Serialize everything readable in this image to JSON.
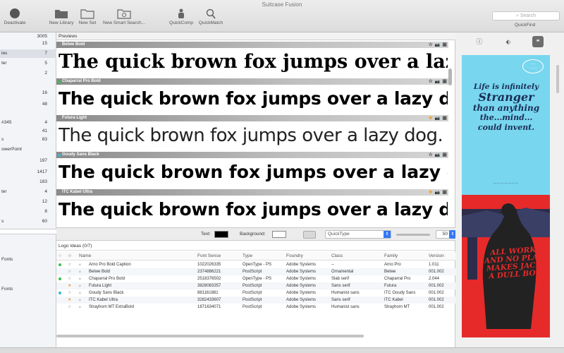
{
  "window": {
    "title": "Suitcase Fusion"
  },
  "toolbar": {
    "deactivate_label": "Deactivate",
    "new_library_label": "New Library",
    "new_set_label": "New Set",
    "new_smart_search_label": "New Smart Search...",
    "quickcomp_label": "QuickComp",
    "quickmatch_label": "QuickMatch",
    "search_placeholder": "Search",
    "quickfind_label": "QuickFind"
  },
  "sidebar": {
    "rows": [
      {
        "label": "",
        "count": "3005"
      },
      {
        "label": "",
        "count": "15"
      },
      {
        "label": "ies",
        "count": "7"
      },
      {
        "label": "ter",
        "count": "5"
      },
      {
        "label": "",
        "count": "2"
      },
      {
        "label": "",
        "count": "16"
      },
      {
        "label": "",
        "count": "48"
      },
      {
        "label": "#345",
        "count": "4"
      },
      {
        "label": "",
        "count": "41"
      },
      {
        "label": "s",
        "count": "83"
      },
      {
        "label": "owerPoint",
        "count": ""
      },
      {
        "label": "",
        "count": "197"
      },
      {
        "label": "",
        "count": "1417"
      },
      {
        "label": "",
        "count": "183"
      },
      {
        "label": "ter",
        "count": "4"
      },
      {
        "label": "",
        "count": "12"
      },
      {
        "label": "",
        "count": "8"
      },
      {
        "label": "s",
        "count": "60"
      },
      {
        "label": "Fonts",
        "count": ""
      },
      {
        "label": "Fonts",
        "count": ""
      }
    ]
  },
  "previews": {
    "header": "Previews",
    "sample_text": "The quick brown fox jumps over a lazy dog.",
    "fonts": [
      {
        "name": "Belwe Bold",
        "dot_color": "",
        "starred": false
      },
      {
        "name": "Chaparral Pro Bold",
        "dot_color": "#3dbd4a",
        "starred": false
      },
      {
        "name": "Futura Light",
        "dot_color": "",
        "starred": true
      },
      {
        "name": "Goudy Sans Black",
        "dot_color": "#39b6d8",
        "starred": false
      },
      {
        "name": "ITC Kabel Ultra",
        "dot_color": "",
        "starred": true
      }
    ],
    "star_empty": "☆",
    "star_filled": "★",
    "camera_icon": "📷",
    "action_icon": "▣"
  },
  "controls": {
    "text_label": "Text:",
    "background_label": "Background:",
    "text_color": "#000000",
    "background_color": "#ffffff",
    "quicktype_label": "QuickType",
    "size_value": "50"
  },
  "list": {
    "title": "Logo Ideas (0/7)",
    "columns": [
      "Name",
      "Font Sense",
      "Type",
      "Foundry",
      "Class",
      "Family",
      "Version"
    ],
    "rows": [
      {
        "dot": "#3dbd4a",
        "starred": false,
        "name": "Arno Pro Bold Caption",
        "sense": "1022026335",
        "type": "OpenType - PS",
        "foundry": "Adobe Systems",
        "class": "--",
        "family": "Arno Pro",
        "version": "1.011"
      },
      {
        "dot": "",
        "starred": false,
        "name": "Belwe Bold",
        "sense": "2374886221",
        "type": "PostScript",
        "foundry": "Adobe Systems",
        "class": "Ornamental",
        "family": "Belwe",
        "version": "001.002"
      },
      {
        "dot": "#3dbd4a",
        "starred": false,
        "name": "Chaparral Pro Bold",
        "sense": "2518376502",
        "type": "OpenType - PS",
        "foundry": "Adobe Systems",
        "class": "Slab serif",
        "family": "Chaparral Pro",
        "version": "2.044"
      },
      {
        "dot": "",
        "starred": true,
        "name": "Futura Light",
        "sense": "3828083357",
        "type": "PostScript",
        "foundry": "Adobe Systems",
        "class": "Sans serif",
        "family": "Futura",
        "version": "001.002"
      },
      {
        "dot": "#39b6d8",
        "starred": false,
        "name": "Goudy Sans Black",
        "sense": "881161881",
        "type": "PostScript",
        "foundry": "Adobe Systems",
        "class": "Humanist sans",
        "family": "ITC Goudy Sans",
        "version": "001.002"
      },
      {
        "dot": "",
        "starred": true,
        "name": "ITC Kabel Ultra",
        "sense": "3282433607",
        "type": "PostScript",
        "foundry": "Adobe Systems",
        "class": "Sans serif",
        "family": "ITC Kabel",
        "version": "001.002"
      },
      {
        "dot": "",
        "starred": false,
        "name": "Strayhorn MT ExtraBold",
        "sense": "1871634071",
        "type": "PostScript",
        "foundry": "Adobe Systems",
        "class": "Humanist sans",
        "family": "Strayhorn MT",
        "version": "001.002"
      }
    ]
  },
  "right_panel": {
    "tabs": [
      "info-icon",
      "tag-icon",
      "quote-icon"
    ],
    "poster1": {
      "line1": "Life is infinitely",
      "line2": "Stranger",
      "line3": "than anything",
      "line4": "the...mind...",
      "line5": "could invent."
    },
    "poster2": {
      "text": "ALL WORK AND NO PLAY MAKES JACK A DULL BOY"
    }
  }
}
